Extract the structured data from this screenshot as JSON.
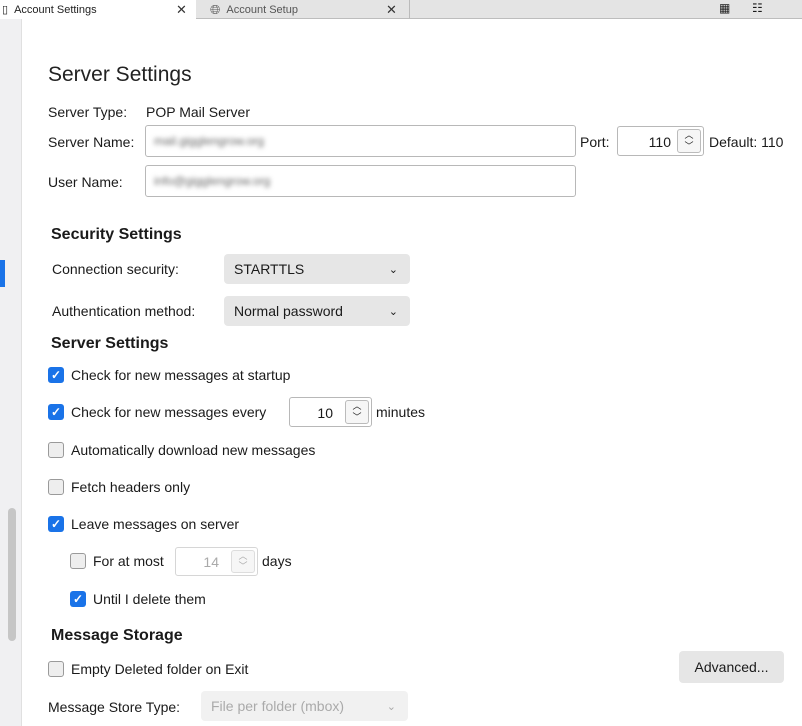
{
  "tabs": [
    {
      "label": "Account Settings",
      "icon": "book-icon",
      "active": true
    },
    {
      "label": "Account Setup",
      "icon": "globe-icon",
      "active": false
    }
  ],
  "toolbar_icons": [
    "calendar-icon",
    "tasks-icon"
  ],
  "page_title": "Server Settings",
  "server_type_label": "Server Type:",
  "server_type_value": "POP Mail Server",
  "server_name_label": "Server Name:",
  "server_name_value": "mail.gigglengrow.org",
  "port_label": "Port:",
  "port_value": "110",
  "port_default": "Default: 110",
  "user_name_label": "User Name:",
  "user_name_value": "info@gigglengrow.org",
  "security": {
    "heading": "Security Settings",
    "connection_label": "Connection security:",
    "connection_value": "STARTTLS",
    "auth_label": "Authentication method:",
    "auth_value": "Normal password"
  },
  "server": {
    "heading": "Server Settings",
    "check_startup": {
      "label": "Check for new messages at startup",
      "checked": true
    },
    "check_every": {
      "label": "Check for new messages every",
      "checked": true,
      "value": "10",
      "unit": "minutes"
    },
    "auto_download": {
      "label": "Automatically download new messages",
      "checked": false
    },
    "headers_only": {
      "label": "Fetch headers only",
      "checked": false
    },
    "leave_on_server": {
      "label": "Leave messages on server",
      "checked": true
    },
    "at_most": {
      "label": "For at most",
      "checked": false,
      "value": "14",
      "unit": "days"
    },
    "until_delete": {
      "label": "Until I delete them",
      "checked": true
    }
  },
  "storage": {
    "heading": "Message Storage",
    "empty_deleted": {
      "label": "Empty Deleted folder on Exit",
      "checked": false
    },
    "advanced_label": "Advanced...",
    "store_type_label": "Message Store Type:",
    "store_type_value": "File per folder (mbox)"
  },
  "accent_color": "#1a73e8"
}
